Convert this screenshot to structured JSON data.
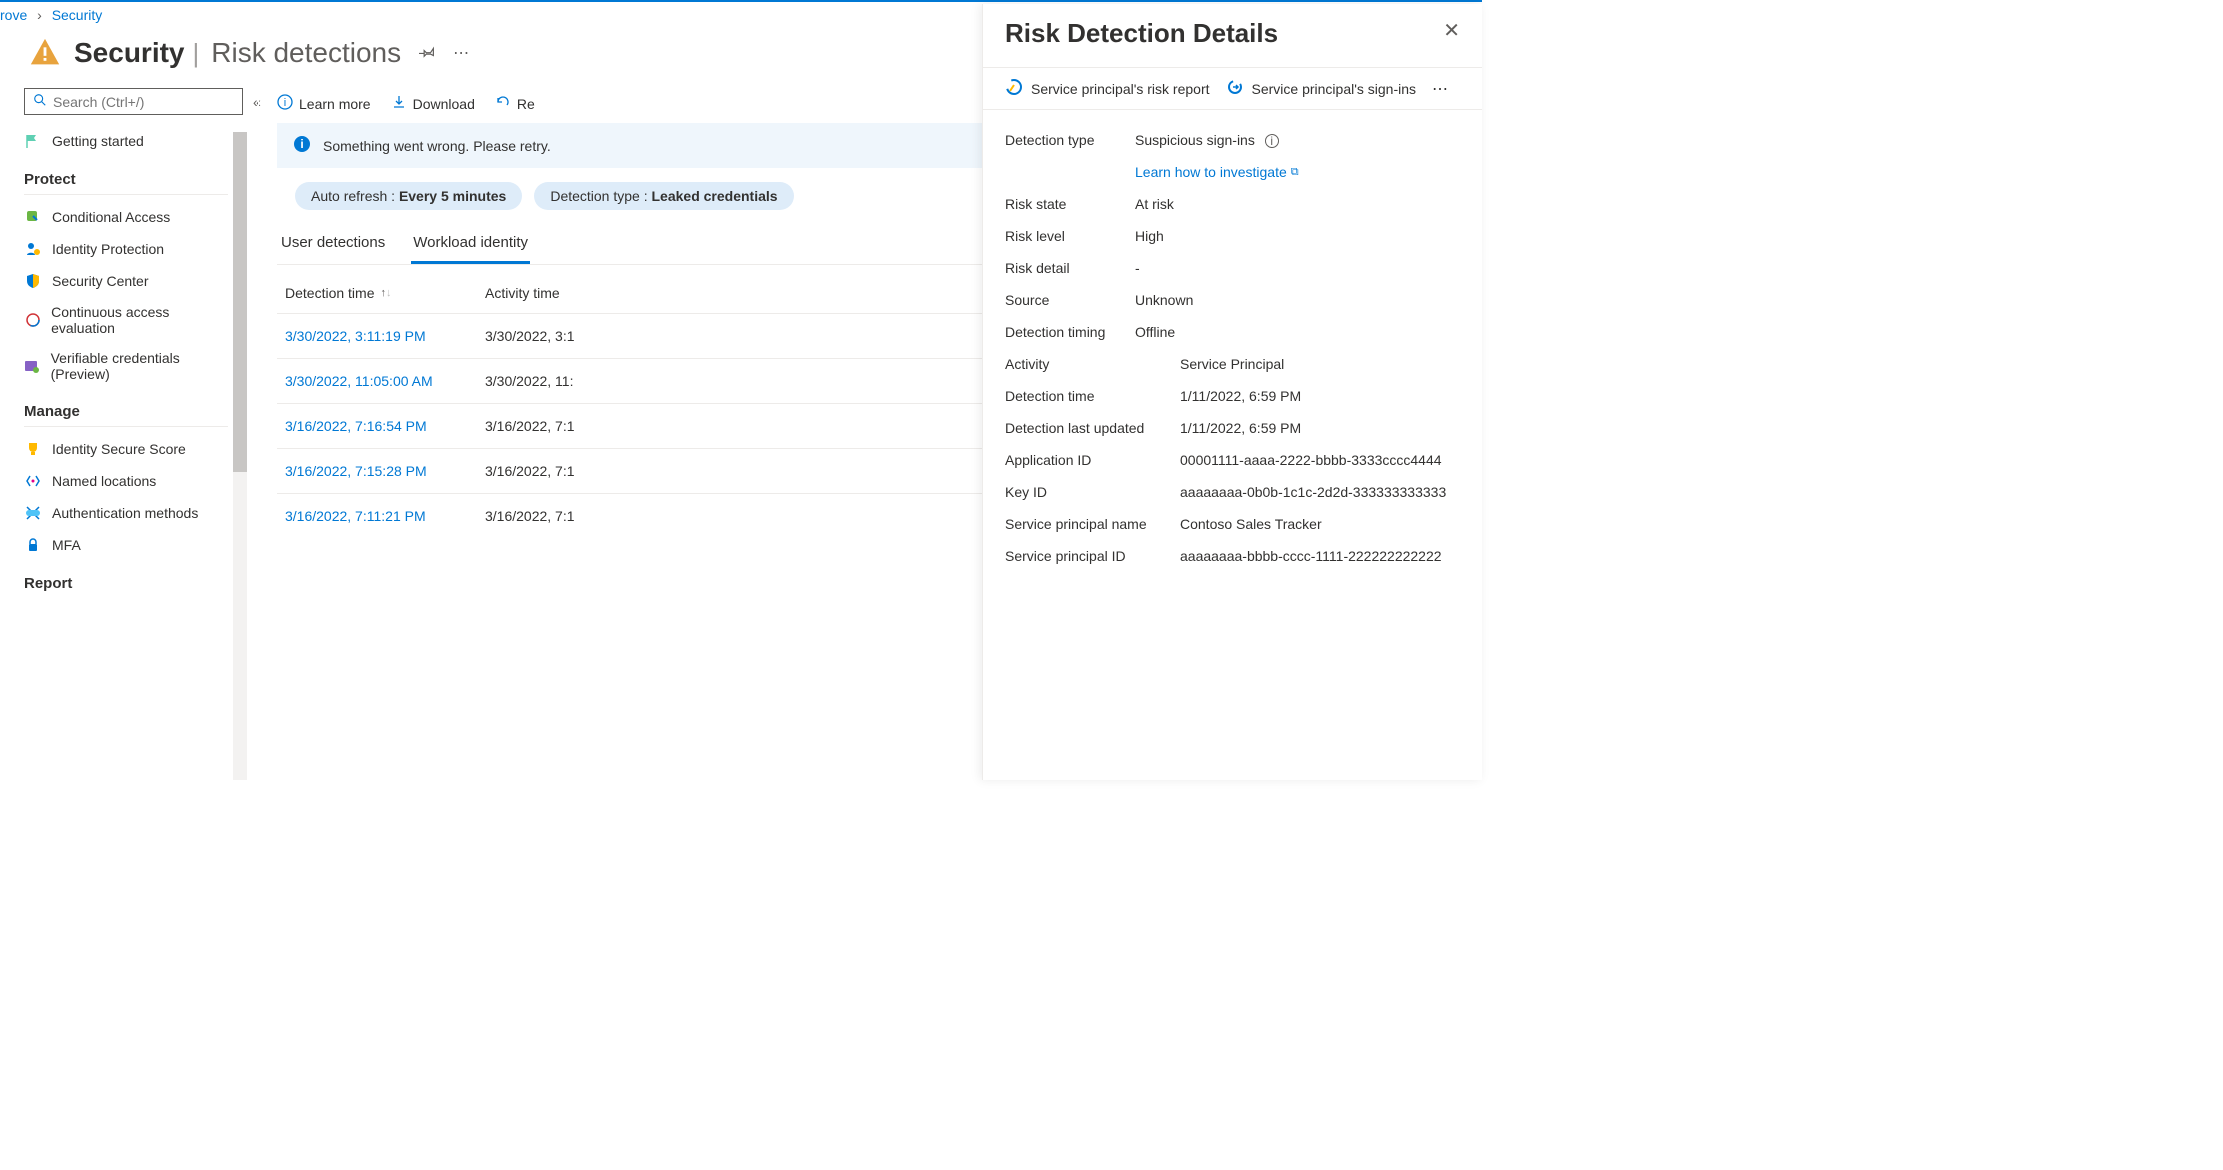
{
  "breadcrumb": {
    "item1": "rove",
    "item2": "Security"
  },
  "header": {
    "title": "Security",
    "subtitle": "Risk detections"
  },
  "sidebar": {
    "search_placeholder": "Search (Ctrl+/)",
    "getting_started": "Getting started",
    "section_protect": "Protect",
    "protect": [
      "Conditional Access",
      "Identity Protection",
      "Security Center",
      "Continuous access evaluation",
      "Verifiable credentials (Preview)"
    ],
    "section_manage": "Manage",
    "manage": [
      "Identity Secure Score",
      "Named locations",
      "Authentication methods",
      "MFA"
    ],
    "section_report": "Report"
  },
  "toolbar": {
    "learn_more": "Learn more",
    "download": "Download",
    "refresh": "Re"
  },
  "error_banner": "Something went wrong. Please retry.",
  "pills": {
    "auto_refresh_label": "Auto refresh : ",
    "auto_refresh_value": "Every 5 minutes",
    "detection_type_label": "Detection type : ",
    "detection_type_value": "Leaked credentials"
  },
  "tabs": {
    "user": "User detections",
    "workload": "Workload identity"
  },
  "table": {
    "col1": "Detection time",
    "col2": "Activity time",
    "rows": [
      {
        "detection": "3/30/2022, 3:11:19 PM",
        "activity": "3/30/2022, 3:1"
      },
      {
        "detection": "3/30/2022, 11:05:00 AM",
        "activity": "3/30/2022, 11:"
      },
      {
        "detection": "3/16/2022, 7:16:54 PM",
        "activity": "3/16/2022, 7:1"
      },
      {
        "detection": "3/16/2022, 7:15:28 PM",
        "activity": "3/16/2022, 7:1"
      },
      {
        "detection": "3/16/2022, 7:11:21 PM",
        "activity": "3/16/2022, 7:1"
      }
    ]
  },
  "details": {
    "title": "Risk Detection Details",
    "tb1": "Service principal's risk report",
    "tb2": "Service principal's sign-ins",
    "detection_type_label": "Detection type",
    "detection_type": "Suspicious sign-ins",
    "learn_link": "Learn how to investigate",
    "risk_state_label": "Risk state",
    "risk_state": "At risk",
    "risk_level_label": "Risk level",
    "risk_level": "High",
    "risk_detail_label": "Risk detail",
    "risk_detail": "-",
    "source_label": "Source",
    "source": "Unknown",
    "detection_timing_label": "Detection timing",
    "detection_timing": "Offline",
    "activity_label": "Activity",
    "activity": "Service Principal",
    "detection_time_label": "Detection time",
    "detection_time": "1/11/2022, 6:59 PM",
    "detection_updated_label": "Detection last updated",
    "detection_updated": "1/11/2022, 6:59 PM",
    "app_id_label": "Application ID",
    "app_id": "00001111-aaaa-2222-bbbb-3333cccc4444",
    "key_id_label": "Key ID",
    "key_id": "aaaaaaaa-0b0b-1c1c-2d2d-333333333333",
    "sp_name_label": "Service principal name",
    "sp_name": "Contoso Sales Tracker",
    "sp_id_label": "Service principal ID",
    "sp_id": "aaaaaaaa-bbbb-cccc-1111-222222222222"
  }
}
